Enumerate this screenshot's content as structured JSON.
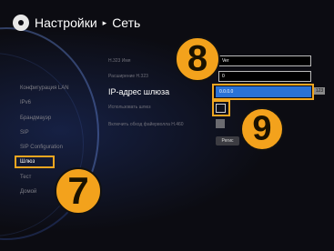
{
  "header": {
    "title": "Настройки",
    "arrow": "▸",
    "section": "Сеть"
  },
  "sidebar": {
    "items": [
      {
        "label": "Конфигурация LAN"
      },
      {
        "label": "IPv6"
      },
      {
        "label": "Брандмауэр"
      },
      {
        "label": "SIP"
      },
      {
        "label": "SIP Configuration"
      },
      {
        "label": "Шлюз"
      },
      {
        "label": "Тест"
      },
      {
        "label": "Домой"
      }
    ]
  },
  "form": {
    "h323_name": {
      "label": "H.323 Имя",
      "value": "Ver"
    },
    "h323_ext": {
      "label": "Расширение H.323",
      "value": "0"
    },
    "gateway_ip": {
      "label": "IP-адрес шлюза",
      "value": "0.0.0.0",
      "keyboard_hint": "123"
    },
    "use_gateway": {
      "label": "Использовать шлюз"
    },
    "h460": {
      "label": "Включить обход файерволла H.460"
    },
    "register_button": "Регис"
  },
  "badges": {
    "b7": "7",
    "b8": "8",
    "b9": "9"
  },
  "colors": {
    "accent": "#f0a620",
    "selected": "#2a72d6"
  }
}
